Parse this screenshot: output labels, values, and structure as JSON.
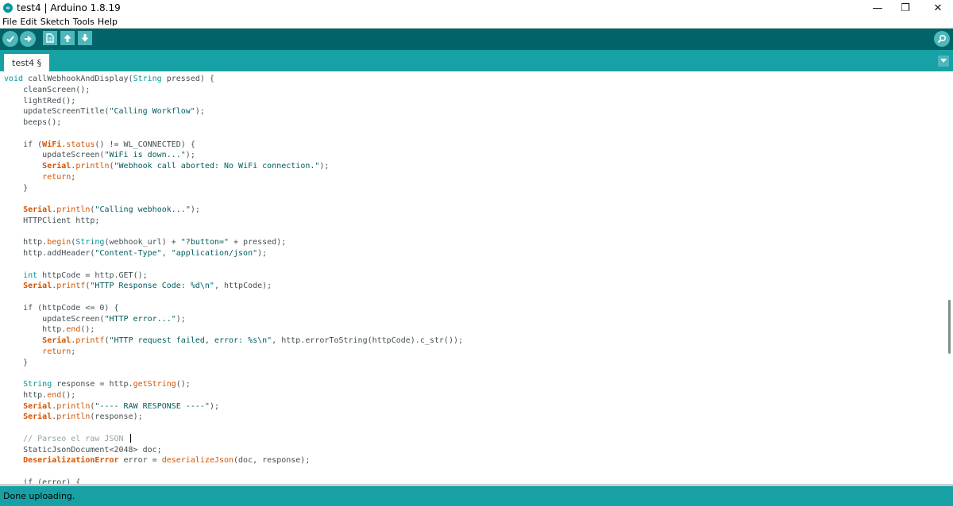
{
  "window": {
    "title": "test4 | Arduino 1.8.19",
    "logo_glyph": "∞",
    "minimize_glyph": "—",
    "restore_glyph": "❐",
    "close_glyph": "✕"
  },
  "menu": [
    "File",
    "Edit",
    "Sketch",
    "Tools",
    "Help"
  ],
  "toolbar": {
    "buttons": [
      "verify-icon",
      "upload-icon",
      "new-icon",
      "open-icon",
      "save-icon"
    ],
    "serial_monitor": "serial-monitor-icon"
  },
  "tabs": [
    {
      "label": "test4 §",
      "active": true
    }
  ],
  "editor": {
    "lines": [
      [
        [
          "void",
          "kw"
        ],
        [
          " callWebhookAndDisplay(",
          "pl"
        ],
        [
          "String",
          "kw"
        ],
        [
          " pressed) {",
          "pl"
        ]
      ],
      [
        [
          "    cleanScreen();",
          "pl"
        ]
      ],
      [
        [
          "    lightRed();",
          "pl"
        ]
      ],
      [
        [
          "    updateScreenTitle(",
          "pl"
        ],
        [
          "\"Calling Workflow\"",
          "str"
        ],
        [
          ");",
          "pl"
        ]
      ],
      [
        [
          "    beeps();",
          "pl"
        ]
      ],
      [],
      [
        [
          "    if (",
          "pl"
        ],
        [
          "WiFi",
          "cls"
        ],
        [
          ".",
          "pl"
        ],
        [
          "status",
          "fn"
        ],
        [
          "() != WL_CONNECTED) {",
          "pl"
        ]
      ],
      [
        [
          "        updateScreen(",
          "pl"
        ],
        [
          "\"WiFi is down...\"",
          "str"
        ],
        [
          ");",
          "pl"
        ]
      ],
      [
        [
          "        ",
          "pl"
        ],
        [
          "Serial",
          "cls"
        ],
        [
          ".",
          "pl"
        ],
        [
          "println",
          "fn"
        ],
        [
          "(",
          "pl"
        ],
        [
          "\"Webhook call aborted: No WiFi connection.\"",
          "str"
        ],
        [
          ");",
          "pl"
        ]
      ],
      [
        [
          "        ",
          "pl"
        ],
        [
          "return",
          "fn"
        ],
        [
          ";",
          "pl"
        ]
      ],
      [
        [
          "    }",
          "pl"
        ]
      ],
      [],
      [
        [
          "    ",
          "pl"
        ],
        [
          "Serial",
          "cls"
        ],
        [
          ".",
          "pl"
        ],
        [
          "println",
          "fn"
        ],
        [
          "(",
          "pl"
        ],
        [
          "\"Calling webhook...\"",
          "str"
        ],
        [
          ");",
          "pl"
        ]
      ],
      [
        [
          "    HTTPClient http;",
          "pl"
        ]
      ],
      [],
      [
        [
          "    http.",
          "pl"
        ],
        [
          "begin",
          "fn"
        ],
        [
          "(",
          "pl"
        ],
        [
          "String",
          "kw"
        ],
        [
          "(webhook_url) + ",
          "pl"
        ],
        [
          "\"?button=\"",
          "str"
        ],
        [
          " + pressed);",
          "pl"
        ]
      ],
      [
        [
          "    http.addHeader(",
          "pl"
        ],
        [
          "\"Content-Type\"",
          "str"
        ],
        [
          ", ",
          "pl"
        ],
        [
          "\"application/json\"",
          "str"
        ],
        [
          ");",
          "pl"
        ]
      ],
      [],
      [
        [
          "    ",
          "pl"
        ],
        [
          "int",
          "kw"
        ],
        [
          " httpCode = http.GET();",
          "pl"
        ]
      ],
      [
        [
          "    ",
          "pl"
        ],
        [
          "Serial",
          "cls"
        ],
        [
          ".",
          "pl"
        ],
        [
          "printf",
          "fn"
        ],
        [
          "(",
          "pl"
        ],
        [
          "\"HTTP Response Code: %d\\n\"",
          "str"
        ],
        [
          ", httpCode);",
          "pl"
        ]
      ],
      [],
      [
        [
          "    if (httpCode <= 0) {",
          "pl"
        ]
      ],
      [
        [
          "        updateScreen(",
          "pl"
        ],
        [
          "\"HTTP error...\"",
          "str"
        ],
        [
          ");",
          "pl"
        ]
      ],
      [
        [
          "        http.",
          "pl"
        ],
        [
          "end",
          "fn"
        ],
        [
          "();",
          "pl"
        ]
      ],
      [
        [
          "        ",
          "pl"
        ],
        [
          "Serial",
          "cls"
        ],
        [
          ".",
          "pl"
        ],
        [
          "printf",
          "fn"
        ],
        [
          "(",
          "pl"
        ],
        [
          "\"HTTP request failed, error: %s\\n\"",
          "str"
        ],
        [
          ", http.errorToString(httpCode).c_str());",
          "pl"
        ]
      ],
      [
        [
          "        ",
          "pl"
        ],
        [
          "return",
          "fn"
        ],
        [
          ";",
          "pl"
        ]
      ],
      [
        [
          "    }",
          "pl"
        ]
      ],
      [],
      [
        [
          "    ",
          "pl"
        ],
        [
          "String",
          "kw"
        ],
        [
          " response = http.",
          "pl"
        ],
        [
          "getString",
          "fn"
        ],
        [
          "();",
          "pl"
        ]
      ],
      [
        [
          "    http.",
          "pl"
        ],
        [
          "end",
          "fn"
        ],
        [
          "();",
          "pl"
        ]
      ],
      [
        [
          "    ",
          "pl"
        ],
        [
          "Serial",
          "cls"
        ],
        [
          ".",
          "pl"
        ],
        [
          "println",
          "fn"
        ],
        [
          "(",
          "pl"
        ],
        [
          "\"---- RAW RESPONSE ----\"",
          "str"
        ],
        [
          ");",
          "pl"
        ]
      ],
      [
        [
          "    ",
          "pl"
        ],
        [
          "Serial",
          "cls"
        ],
        [
          ".",
          "pl"
        ],
        [
          "println",
          "fn"
        ],
        [
          "(response);",
          "pl"
        ]
      ],
      [],
      [
        [
          "    // Parseo el raw JSON ",
          "cm"
        ]
      ],
      [
        [
          "    StaticJsonDocument<2048> doc;",
          "pl"
        ]
      ],
      [
        [
          "    ",
          "pl"
        ],
        [
          "DeserializationError",
          "cls"
        ],
        [
          " error = ",
          "pl"
        ],
        [
          "deserializeJson",
          "fn"
        ],
        [
          "(doc, response);",
          "pl"
        ]
      ],
      [],
      [
        [
          "    if (error) {",
          "pl"
        ]
      ]
    ],
    "caret_line": 33
  },
  "status": {
    "message": "Done uploading."
  },
  "colors": {
    "toolbar": "#006468",
    "tabbar": "#17a1a5",
    "button": "#4db7bb",
    "keyword": "#00979c",
    "function": "#d35400",
    "string": "#005c5f",
    "comment": "#95a5a6"
  }
}
